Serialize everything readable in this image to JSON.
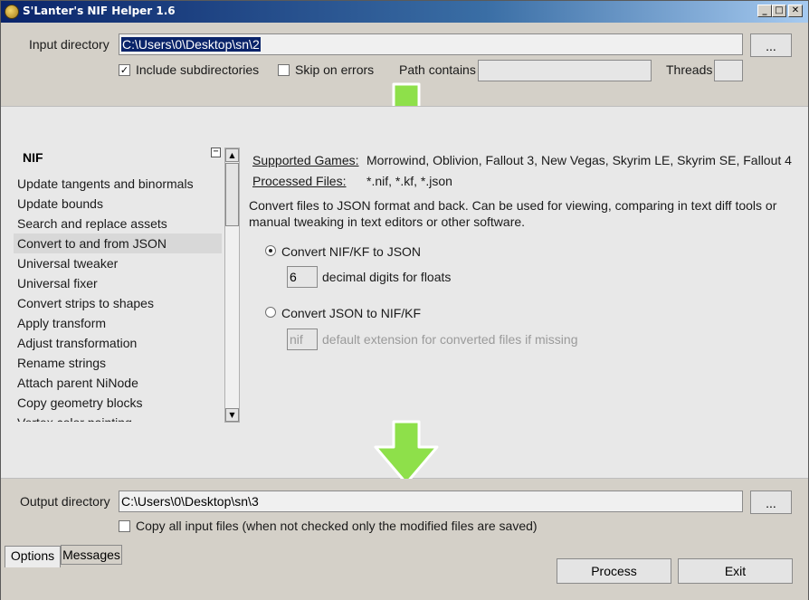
{
  "window": {
    "title": "S'Lanter's NIF Helper 1.6",
    "controls": {
      "minimize": "_",
      "maximize": "□",
      "close": "✕"
    }
  },
  "input": {
    "label": "Input directory",
    "value": "C:\\Users\\0\\Desktop\\sn\\2",
    "browse_label": "...",
    "include_subdirs_label": "Include subdirectories",
    "include_subdirs_checked": true,
    "skip_errors_label": "Skip on errors",
    "skip_errors_checked": false,
    "path_contains_label": "Path contains",
    "path_contains_value": "",
    "threads_label": "Threads",
    "threads_value": ""
  },
  "arrows": {
    "icon": "down-arrow-icon",
    "color": "#8ee04a"
  },
  "list": {
    "header": "NIF",
    "collapse_symbol": "−",
    "items": [
      "Update tangents and binormals",
      "Update bounds",
      "Search and replace assets",
      "Convert to and from JSON",
      "Universal tweaker",
      "Universal fixer",
      "Convert strips to shapes",
      "Apply transform",
      "Adjust transformation",
      "Rename strings",
      "Attach parent NiNode",
      "Copy geometry blocks",
      "Vertex color painting"
    ],
    "selected_index": 3,
    "scroll_up": "▲",
    "scroll_down": "▼"
  },
  "details": {
    "supported_games_label": "Supported Games:",
    "supported_games_value": "Morrowind, Oblivion, Fallout 3, New Vegas, Skyrim LE, Skyrim SE, Fallout 4",
    "processed_files_label": "Processed Files:",
    "processed_files_value": "*.nif, *.kf, *.json",
    "description_line1": "Convert files to JSON format and back. Can be used for viewing, comparing in text diff tools or",
    "description_line2": "manual tweaking in text editors or other software.",
    "option1_label": "Convert NIF/KF to JSON",
    "option1_checked": true,
    "digits_value": "6",
    "digits_label": "decimal digits for floats",
    "option2_label": "Convert JSON to NIF/KF",
    "option2_checked": false,
    "ext_value": "nif",
    "ext_label": "default extension for converted files if missing"
  },
  "output": {
    "label": "Output directory",
    "value": "C:\\Users\\0\\Desktop\\sn\\3",
    "browse_label": "...",
    "copy_all_label": "Copy all input files (when not checked only the modified files are saved)",
    "copy_all_checked": false
  },
  "tabs": {
    "options": "Options",
    "messages": "Messages"
  },
  "actions": {
    "process": "Process",
    "exit": "Exit"
  }
}
